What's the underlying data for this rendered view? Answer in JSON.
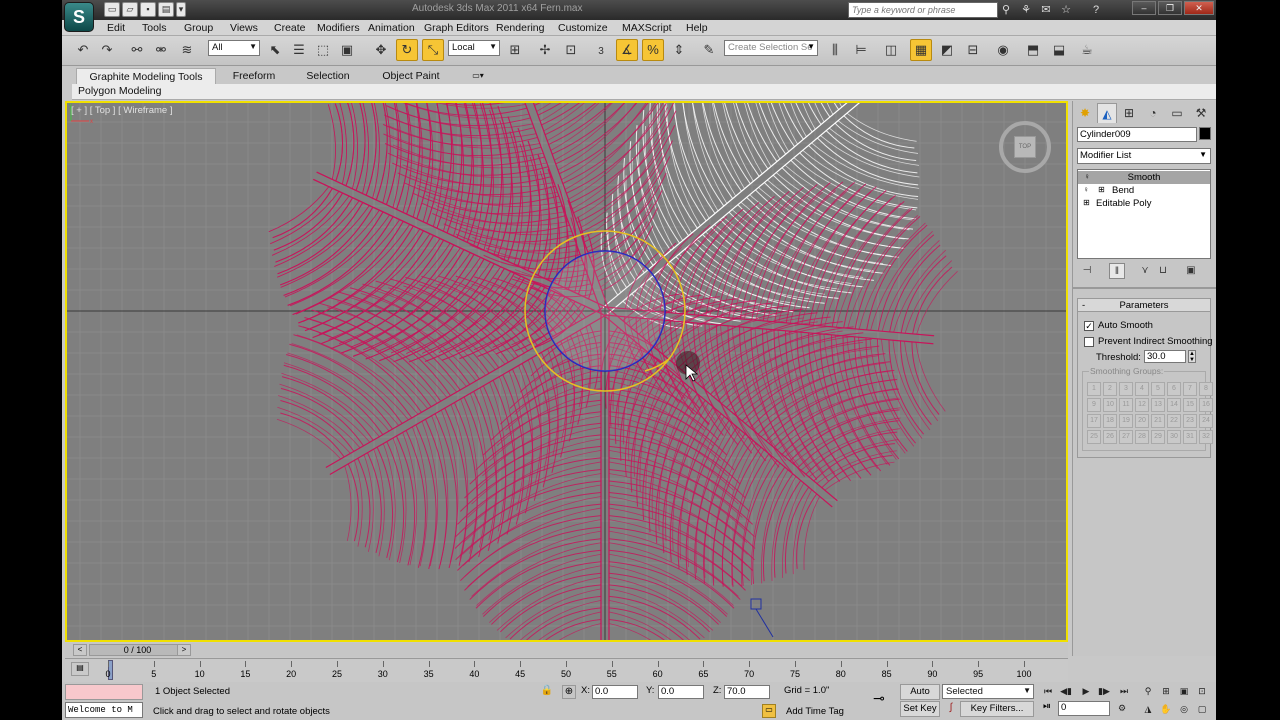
{
  "app": {
    "logo_text": "S",
    "title": "Autodesk 3ds Max  2011 x64      Fern.max",
    "search_placeholder": "Type a keyword or phrase"
  },
  "quick_access": [
    "new-file-icon",
    "open-file-icon",
    "save-icon",
    "project-folder-icon",
    "dropdown-icon"
  ],
  "window_buttons": {
    "minimize": "–",
    "restore": "❐",
    "close": "✕"
  },
  "menu": [
    "Edit",
    "Tools",
    "Group",
    "Views",
    "Create",
    "Modifiers",
    "Animation",
    "Graph Editors",
    "Rendering",
    "Customize",
    "MAXScript",
    "Help"
  ],
  "toolbar": {
    "selection_filter": "All",
    "ref_coord": "Local",
    "named_selection_placeholder": "Create Selection Se",
    "snap_label": "3",
    "active_tools": [
      "rotate",
      "scale-region",
      "angle-snap",
      "percent-snap"
    ]
  },
  "ribbon": {
    "tabs": [
      "Graphite Modeling Tools",
      "Freeform",
      "Selection",
      "Object Paint"
    ],
    "active_tab": "Graphite Modeling Tools",
    "panel_label": "Polygon Modeling"
  },
  "viewport": {
    "label": "[ + ] [ Top ] [ Wireframe ]",
    "viewcube_label": "TOP",
    "border_color": "#f0e000",
    "bg_color": "#7f7f7f",
    "wire_color": "#c8145a",
    "selected_wire_color": "#ffffff",
    "gizmo_outer_color": "#e8c020",
    "gizmo_inner_color": "#2020c0"
  },
  "command_panel": {
    "object_name": "Cylinder009",
    "object_color": "#000000",
    "modifier_list_label": "Modifier List",
    "stack": [
      {
        "label": "Smooth",
        "selected": true
      },
      {
        "label": "Bend",
        "selected": false
      },
      {
        "label": "Editable Poly",
        "selected": false
      }
    ],
    "rollout_title": "Parameters",
    "auto_smooth_label": "Auto Smooth",
    "auto_smooth_checked": true,
    "prevent_indirect_label": "Prevent Indirect Smoothing",
    "prevent_indirect_checked": false,
    "threshold_label": "Threshold:",
    "threshold_value": "30.0",
    "smoothing_groups_label": "Smoothing Groups:",
    "smoothing_groups": [
      "1",
      "2",
      "3",
      "4",
      "5",
      "6",
      "7",
      "8",
      "9",
      "10",
      "11",
      "12",
      "13",
      "14",
      "15",
      "16",
      "17",
      "18",
      "19",
      "20",
      "21",
      "22",
      "23",
      "24",
      "25",
      "26",
      "27",
      "28",
      "29",
      "30",
      "31",
      "32"
    ]
  },
  "timeline": {
    "frame_label": "0 / 100",
    "ticks": [
      0,
      5,
      10,
      15,
      20,
      25,
      30,
      35,
      40,
      45,
      50,
      55,
      60,
      65,
      70,
      75,
      80,
      85,
      90,
      95,
      100
    ]
  },
  "status": {
    "listener_text": "Welcome to M",
    "selection_text": "1 Object Selected",
    "prompt_text": "Click and drag to select and rotate objects",
    "x_label": "X:",
    "x_value": "0.0",
    "y_label": "Y:",
    "y_value": "0.0",
    "z_label": "Z:",
    "z_value": "70.0",
    "grid_text": "Grid = 1.0\"",
    "auto_key": "Auto Key",
    "set_key": "Set Key",
    "key_mode": "Selected",
    "key_filters": "Key Filters...",
    "add_time_tag": "Add Time Tag",
    "current_frame": "0"
  }
}
